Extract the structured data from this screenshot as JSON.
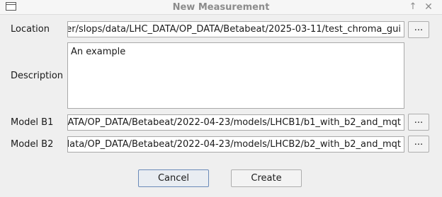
{
  "window": {
    "title": "New Measurement",
    "restore_glyph": "↑",
    "close_glyph": "✕"
  },
  "form": {
    "location": {
      "label": "Location",
      "value": "er/slops/data/LHC_DATA/OP_DATA/Betabeat/2025-03-11/test_chroma_gui",
      "browse_label": "..."
    },
    "description": {
      "label": "Description",
      "value": "An example"
    },
    "model_b1": {
      "label": "Model B1",
      "value": "ATA/OP_DATA/Betabeat/2022-04-23/models/LHCB1/b1_with_b2_and_mqt",
      "browse_label": "..."
    },
    "model_b2": {
      "label": "Model B2",
      "value": "data/OP_DATA/Betabeat/2022-04-23/models/LHCB2/b2_with_b2_and_mqt",
      "browse_label": "..."
    }
  },
  "buttons": {
    "cancel": "Cancel",
    "create": "Create"
  }
}
